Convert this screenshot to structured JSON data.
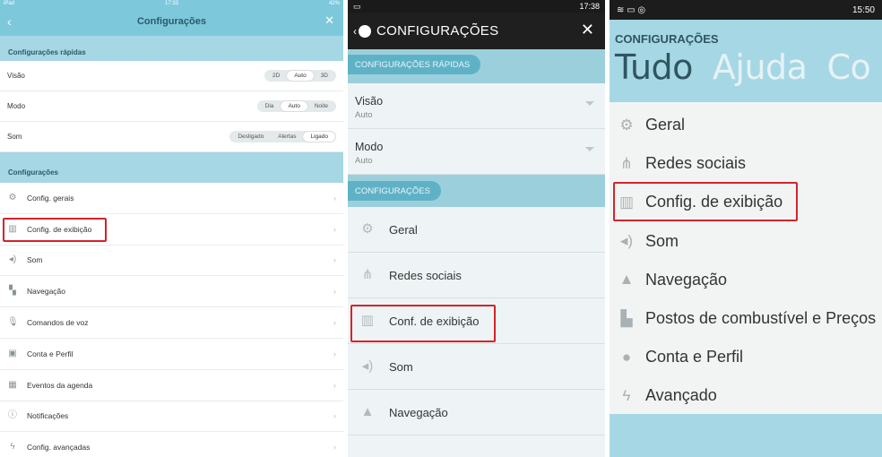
{
  "ios": {
    "status": {
      "carrier": "iPad",
      "time": "17:33",
      "battery": "42%"
    },
    "nav_title": "Configurações",
    "quick_section": "Configurações rápidas",
    "quick": [
      {
        "label": "Visão",
        "options": [
          "2D",
          "Auto",
          "3D"
        ],
        "selected": "Auto"
      },
      {
        "label": "Modo",
        "options": [
          "Dia",
          "Auto",
          "Noite"
        ],
        "selected": "Auto"
      },
      {
        "label": "Som",
        "options": [
          "Desligado",
          "Alertas",
          "Ligado"
        ],
        "selected": "Ligado"
      }
    ],
    "section": "Configurações",
    "items": [
      "Config. gerais",
      "Config. de exibição",
      "Som",
      "Navegação",
      "Comandos de voz",
      "Conta e Perfil",
      "Eventos da agenda",
      "Notificações",
      "Config. avançadas"
    ]
  },
  "android": {
    "status": {
      "time": "17:38"
    },
    "bar_title": "CONFIGURAÇÕES",
    "quick_section": "CONFIGURAÇÕES RÁPIDAS",
    "quick": [
      {
        "label": "Visão",
        "value": "Auto"
      },
      {
        "label": "Modo",
        "value": "Auto"
      }
    ],
    "section": "CONFIGURAÇÕES",
    "items": [
      "Geral",
      "Redes sociais",
      "Conf. de exibição",
      "Som",
      "Navegação"
    ]
  },
  "windows": {
    "status": {
      "time": "15:50"
    },
    "header": "CONFIGURAÇÕES",
    "pivots": [
      "Tudo",
      "Ajuda",
      "Co"
    ],
    "active_pivot": "Tudo",
    "items": [
      "Geral",
      "Redes sociais",
      "Config. de exibição",
      "Som",
      "Navegação",
      "Postos de combustível e Preços",
      "Conta e Perfil",
      "Avançado"
    ]
  },
  "colors": {
    "accent": "#a6d7e5",
    "highlight": "#d5232a",
    "android_bar": "#1f1f1f"
  }
}
